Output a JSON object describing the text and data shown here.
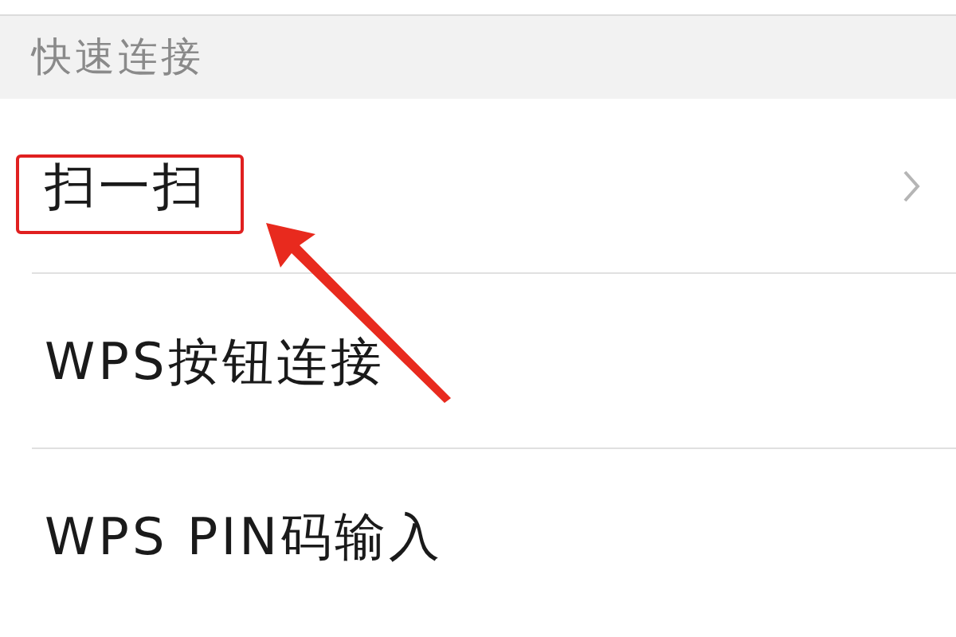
{
  "section": {
    "title": "快速连接"
  },
  "items": [
    {
      "label": "扫一扫",
      "chevron": true,
      "highlighted": true
    },
    {
      "label": "WPS按钮连接",
      "chevron": false,
      "highlighted": false
    },
    {
      "label": "WPS PIN码输入",
      "chevron": false,
      "highlighted": false
    }
  ]
}
